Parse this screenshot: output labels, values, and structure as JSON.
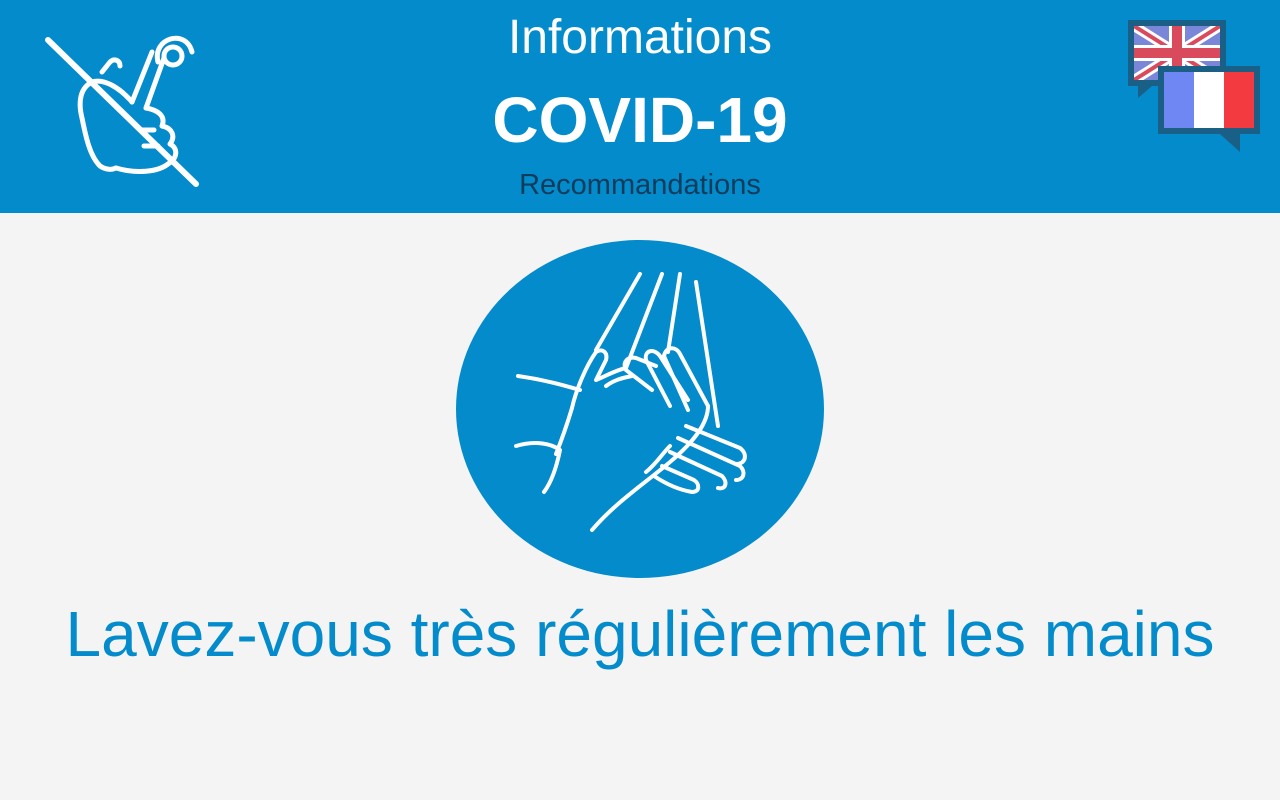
{
  "header": {
    "title_top": "Informations",
    "title_main": "COVID-19",
    "subtitle": "Recommandations",
    "background_color": "#038bcb",
    "left_icon": "no-touch-icon",
    "language_switch": {
      "icon": "language-switch-icon",
      "languages": [
        "English",
        "Français"
      ],
      "active": "Français"
    }
  },
  "main": {
    "illustration_icon": "hand-washing-icon",
    "message": "Lavez-vous très régulièrement les mains",
    "message_color": "#038bcb"
  }
}
